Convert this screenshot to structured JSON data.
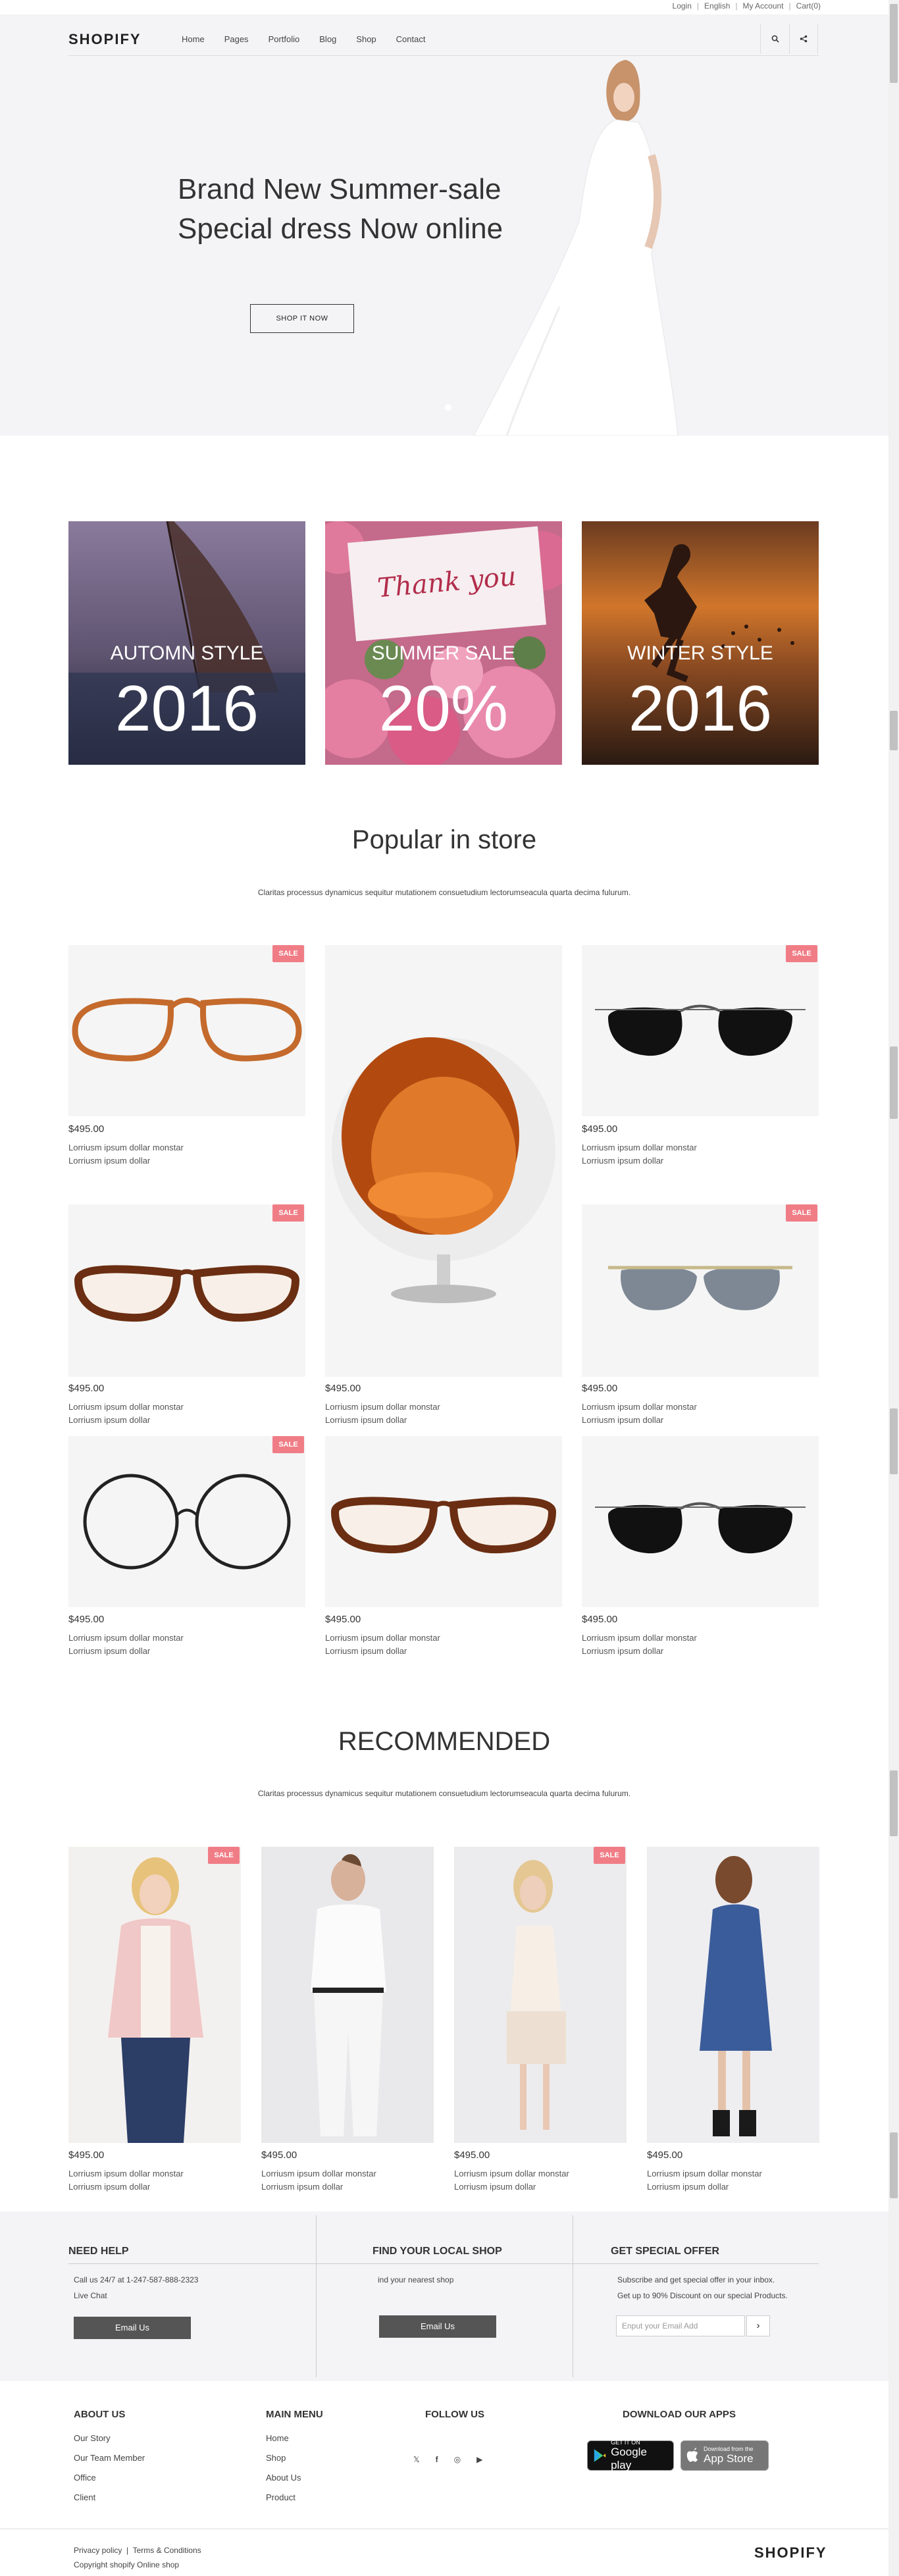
{
  "topbar": {
    "links": [
      "Login",
      "English",
      "My Account",
      "Cart(0)"
    ]
  },
  "header": {
    "logo": "SHOPIFY",
    "nav": [
      "Home",
      "Pages",
      "Portfolio",
      "Blog",
      "Shop",
      "Contact"
    ],
    "icons": [
      "search-icon",
      "share-icon"
    ]
  },
  "hero": {
    "title_line1": "Brand New Summer-sale",
    "title_line2": "Special dress Now online",
    "button": "SHOP IT NOW"
  },
  "banners": [
    {
      "caption": "AUTOMN STYLE",
      "big": "2016"
    },
    {
      "caption": "SUMMER SALE",
      "big": "20%",
      "card_text": "Thank you"
    },
    {
      "caption": "WINTER STYLE",
      "big": "2016"
    }
  ],
  "popular": {
    "title": "Popular in store",
    "subtitle": "Claritas processus dynamicus sequitur mutationem consuetudium lectorumseacula quarta decima fulurum.",
    "sale_label": "SALE",
    "price": "$495.00",
    "desc1": "Lorriusm ipsum dollar monstar",
    "desc2": "Lorriusm ipsum dollar"
  },
  "recommended": {
    "title": "RECOMMENDED",
    "subtitle": "Claritas processus dynamicus sequitur mutationem consuetudium lectorumseacula quarta decima fulurum.",
    "price": "$495.00",
    "desc1": "Lorriusm ipsum dollar monstar",
    "desc2": "Lorriusm ipsum dollar",
    "sale_label": "SALE"
  },
  "help": {
    "title": "NEED HELP",
    "line1": "Call us 24/7 at 1-247-587-888-2323",
    "line2": "Live Chat",
    "button": "Email Us"
  },
  "local": {
    "title": "FIND YOUR LOCAL SHOP",
    "line1": "ind your nearest shop",
    "button": "Email Us"
  },
  "offer": {
    "title": "GET SPECIAL OFFER",
    "line1": "Subscribe and get special offer in your inbox.",
    "line2": "Get up to 90% Discount on our special Products.",
    "placeholder": "Enput your Email Add",
    "go": "›"
  },
  "about": {
    "title": "ABOUT US",
    "items": [
      "Our Story",
      "Our Team Member",
      "Office",
      "Client"
    ]
  },
  "mainmenu": {
    "title": "MAIN MENU",
    "items": [
      "Home",
      "Shop",
      "About Us",
      "Product"
    ]
  },
  "follow": {
    "title": "FOLLOW US",
    "icons": [
      "twitter-icon",
      "facebook-icon",
      "instagram-icon",
      "youtube-icon"
    ]
  },
  "apps": {
    "title": "DOWNLOAD OUR APPS",
    "google_small": "GET IT ON",
    "google_big": "Google play",
    "apple_small": "Download from the",
    "apple_big": "App Store"
  },
  "bottom": {
    "policy": "Privacy policy",
    "terms": "Terms & Conditions",
    "copyright": "Copyright shopify Online shop",
    "logo": "SHOPIFY"
  },
  "colors": {
    "sale": "#f07d86",
    "footer_bg": "#f4f4f6",
    "button_dark": "#555555"
  }
}
